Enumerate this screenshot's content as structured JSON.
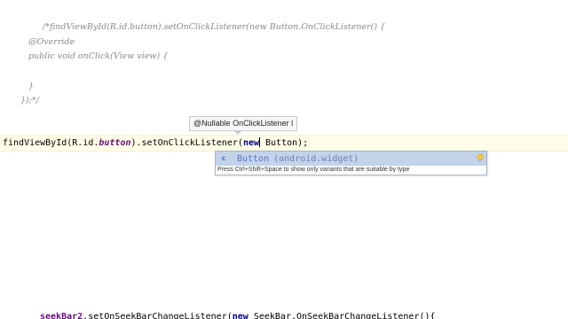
{
  "comment_block": {
    "line1": "/*findViewById(R.id.button).setOnClickListener(new Button.OnClickListener() {",
    "line2": "@Override",
    "line3": "public void onClick(View view) {",
    "line4": "}",
    "line5": "});*/"
  },
  "code_line": {
    "prefix": "findViewById(R.id.",
    "field": "button",
    "middle": ").setOnClickListener(",
    "keyword": "new",
    "suffix": " Button);"
  },
  "param_hint": {
    "text": "@Nullable OnClickListener l"
  },
  "completion": {
    "icon": "class-icon",
    "icon_glyph": "c",
    "item_name": "Button",
    "item_package": "(android.widget)",
    "hint": "Press Ctrl+Shift+Space to show only variants that are suitable by type"
  },
  "bottom_line": {
    "field": "seekBar2",
    "middle": ".setOnSeekBarChangeListener(",
    "keyword": "new",
    "suffix": " SeekBar.OnSeekBarChangeListener(){"
  },
  "colors": {
    "current_line_bg": "#fffde7",
    "selection_bg": "#c2d3ea",
    "comment": "#8a8a8a",
    "field": "#660e7a",
    "keyword": "#000080"
  }
}
